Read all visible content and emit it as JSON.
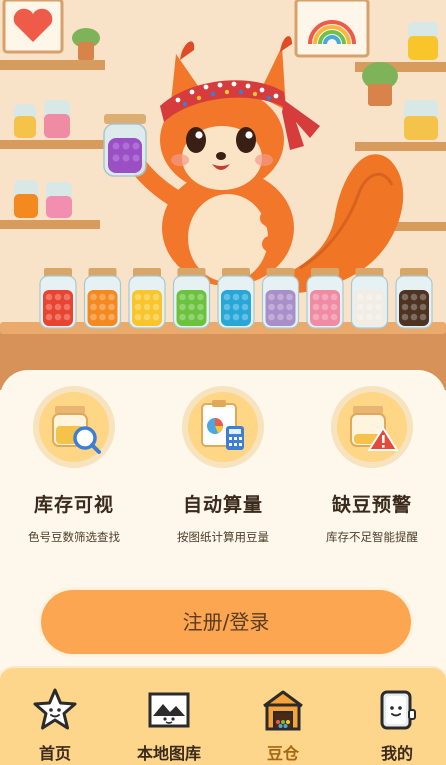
{
  "hero": {
    "jar_colors": [
      "#e8442f",
      "#f48a1f",
      "#f8c62b",
      "#6ac23d",
      "#27a7d8",
      "#a98fc9",
      "#ef8ba3",
      "#f1ece4",
      "#4e3322"
    ],
    "mascot": "squirrel-holding-bead-jar"
  },
  "features": [
    {
      "title": "库存可视",
      "desc": "色号豆数筛选查找",
      "icon": "jar-magnifier-icon"
    },
    {
      "title": "自动算量",
      "desc": "按图纸计算用豆量",
      "icon": "chart-calculator-icon"
    },
    {
      "title": "缺豆预警",
      "desc": "库存不足智能提醒",
      "icon": "jar-warning-icon"
    }
  ],
  "login_button": {
    "label": "注册/登录"
  },
  "nav": [
    {
      "label": "首页",
      "icon": "star-face-icon"
    },
    {
      "label": "本地图库",
      "icon": "gallery-icon"
    },
    {
      "label": "豆仓",
      "icon": "warehouse-icon"
    },
    {
      "label": "我的",
      "icon": "profile-card-icon"
    }
  ],
  "colors": {
    "accent": "#fda652",
    "nav_bg": "#fdd58b",
    "card_bg": "#fdf7ec",
    "active_label": "#a8670e"
  }
}
